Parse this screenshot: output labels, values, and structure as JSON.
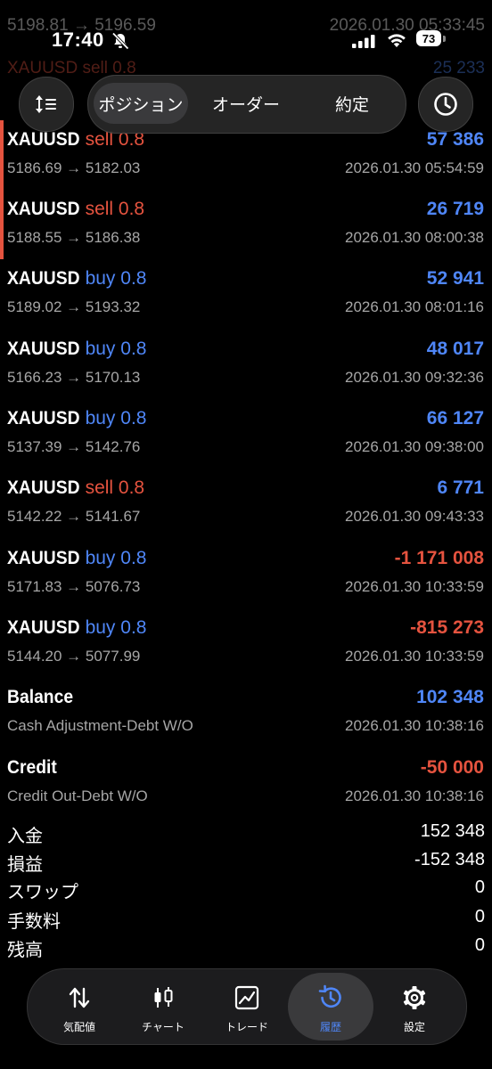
{
  "status_bar": {
    "time": "17:40",
    "battery": "73"
  },
  "faded_top": [
    {
      "left": "5198.81 → 5196.59",
      "right": "2026.01.30 05:33:45"
    },
    {
      "left": "XAUUSD sell 0.8",
      "right": "25 233"
    }
  ],
  "top_nav": {
    "tabs": [
      "ポジション",
      "オーダー",
      "約定"
    ],
    "active_tab": "ポジション"
  },
  "deals": [
    {
      "symbol": "XAUUSD",
      "side": "sell 0.8",
      "side_color": "#e5533f",
      "profit": "57 386",
      "profit_color": "#4f86f7",
      "prices": "5186.69 → 5182.03",
      "time": "2026.01.30 05:54:59",
      "accent": true
    },
    {
      "symbol": "XAUUSD",
      "side": "sell 0.8",
      "side_color": "#e5533f",
      "profit": "26 719",
      "profit_color": "#4f86f7",
      "prices": "5188.55 → 5186.38",
      "time": "2026.01.30 08:00:38",
      "accent": true
    },
    {
      "symbol": "XAUUSD",
      "side": "buy 0.8",
      "side_color": "#4f86f7",
      "profit": "52 941",
      "profit_color": "#4f86f7",
      "prices": "5189.02 → 5193.32",
      "time": "2026.01.30 08:01:16",
      "accent": false
    },
    {
      "symbol": "XAUUSD",
      "side": "buy 0.8",
      "side_color": "#4f86f7",
      "profit": "48 017",
      "profit_color": "#4f86f7",
      "prices": "5166.23 → 5170.13",
      "time": "2026.01.30 09:32:36",
      "accent": false
    },
    {
      "symbol": "XAUUSD",
      "side": "buy 0.8",
      "side_color": "#4f86f7",
      "profit": "66 127",
      "profit_color": "#4f86f7",
      "prices": "5137.39 → 5142.76",
      "time": "2026.01.30 09:38:00",
      "accent": false
    },
    {
      "symbol": "XAUUSD",
      "side": "sell 0.8",
      "side_color": "#e5533f",
      "profit": "6 771",
      "profit_color": "#4f86f7",
      "prices": "5142.22 → 5141.67",
      "time": "2026.01.30 09:43:33",
      "accent": false
    },
    {
      "symbol": "XAUUSD",
      "side": "buy 0.8",
      "side_color": "#4f86f7",
      "profit": "-1 171 008",
      "profit_color": "#e5533f",
      "prices": "5171.83 → 5076.73",
      "time": "2026.01.30 10:33:59",
      "accent": false
    },
    {
      "symbol": "XAUUSD",
      "side": "buy 0.8",
      "side_color": "#4f86f7",
      "profit": "-815 273",
      "profit_color": "#e5533f",
      "prices": "5144.20 → 5077.99",
      "time": "2026.01.30 10:33:59",
      "accent": false
    },
    {
      "symbol": "Balance",
      "side": "",
      "side_color": "#4f86f7",
      "profit": "102 348",
      "profit_color": "#4f86f7",
      "prices": "Cash Adjustment-Debt W/O",
      "time": "2026.01.30 10:38:16",
      "accent": false
    },
    {
      "symbol": "Credit",
      "side": "",
      "side_color": "#4f86f7",
      "profit": "-50 000",
      "profit_color": "#e5533f",
      "prices": "Credit Out-Debt W/O",
      "time": "2026.01.30 10:38:16",
      "accent": false
    }
  ],
  "summary": [
    {
      "label": "入金",
      "value": "152 348"
    },
    {
      "label": "損益",
      "value": "-152 348"
    },
    {
      "label": "スワップ",
      "value": "0"
    },
    {
      "label": "手数料",
      "value": "0"
    },
    {
      "label": "残高",
      "value": "0"
    }
  ],
  "tabbar": {
    "items": [
      {
        "label": "気配値",
        "icon": "quotes-arrows-icon"
      },
      {
        "label": "チャート",
        "icon": "candlestick-icon"
      },
      {
        "label": "トレード",
        "icon": "trade-chart-icon"
      },
      {
        "label": "履歴",
        "icon": "history-icon"
      },
      {
        "label": "設定",
        "icon": "gear-icon"
      }
    ],
    "active": "履歴",
    "accent_color": "#4f86f7"
  }
}
